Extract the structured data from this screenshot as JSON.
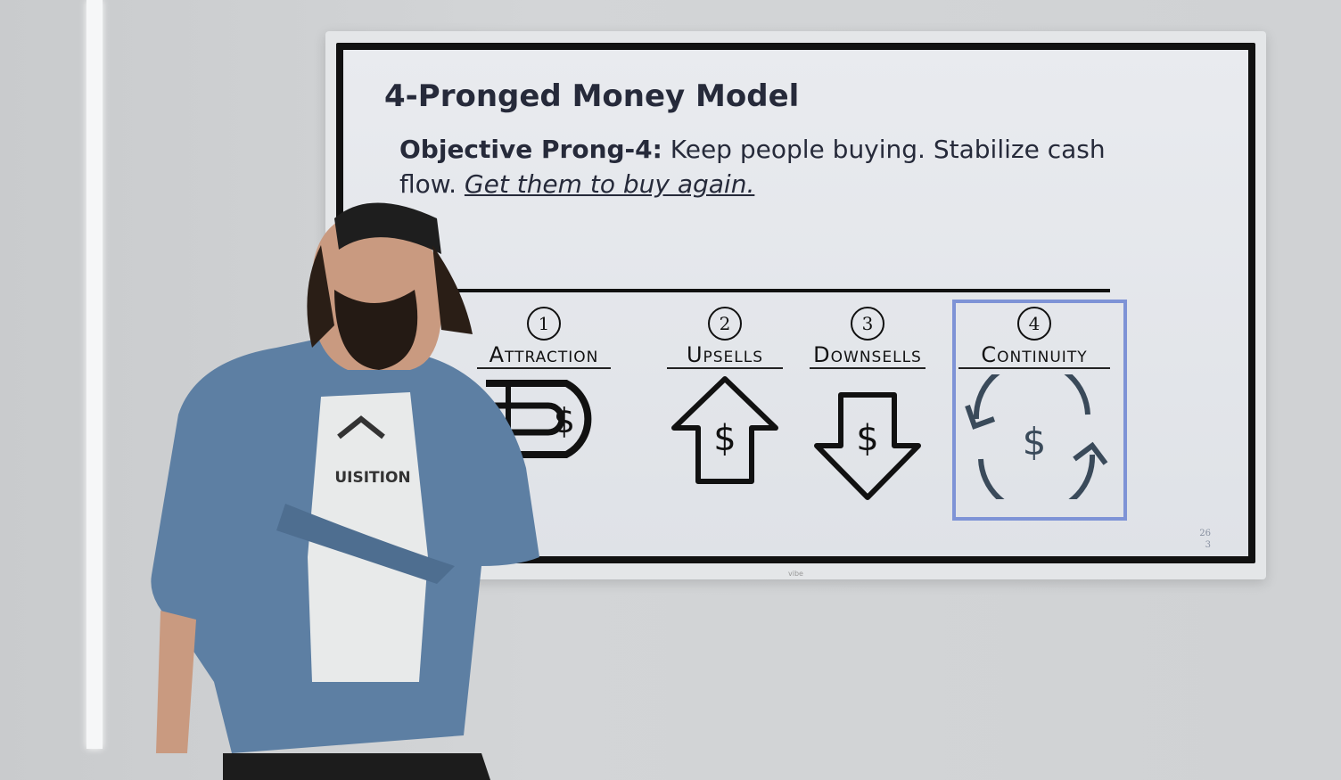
{
  "slide": {
    "title": "4-Pronged Money Model",
    "objective_label": "Objective Prong-4:",
    "objective_text": " Keep people buying. Stabilize cash flow. ",
    "objective_emphasis": "Get them to buy again.",
    "prongs": [
      {
        "number": "1",
        "label": "Attraction",
        "icon": "magnet-dollar-icon"
      },
      {
        "number": "2",
        "label": "Upsells",
        "icon": "arrow-up-dollar-icon"
      },
      {
        "number": "3",
        "label": "Downsells",
        "icon": "arrow-down-dollar-icon"
      },
      {
        "number": "4",
        "label": "Continuity",
        "icon": "cycle-dollar-icon"
      }
    ],
    "page_number": "26",
    "page_sub": "3",
    "highlight_color": "#7e93d6"
  },
  "tv": {
    "brand": "vibe"
  },
  "presenter": {
    "shirt_text": "UISITION"
  }
}
